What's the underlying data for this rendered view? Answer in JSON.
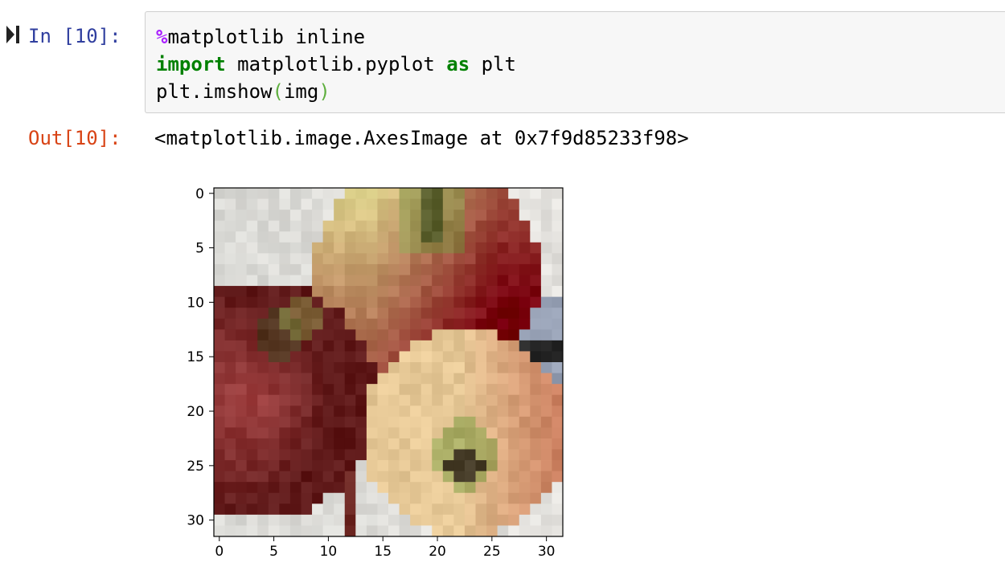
{
  "cell": {
    "input_prompt": {
      "prefix": "In ",
      "number": "[10]:"
    },
    "code": {
      "line1": {
        "magic": "%",
        "text": "matplotlib inline"
      },
      "line2": {
        "kw_import": "import",
        "middle": " matplotlib.pyplot ",
        "kw_as": "as",
        "end": " plt"
      },
      "line3": {
        "call": "plt.imshow",
        "open": "(",
        "arg": "img",
        "close": ")"
      }
    },
    "output_prompt": "Out[10]:",
    "output_text": "<matplotlib.image.AxesImage at 0x7f9d85233f98>"
  },
  "chart_data": {
    "type": "heatmap",
    "title": "",
    "xlabel": "",
    "ylabel": "",
    "xticks": [
      "0",
      "5",
      "10",
      "15",
      "20",
      "25",
      "30"
    ],
    "yticks": [
      "0",
      "5",
      "10",
      "15",
      "20",
      "25",
      "30"
    ],
    "xlim": [
      -0.5,
      31.5
    ],
    "ylim": [
      31.5,
      -0.5
    ],
    "image_size": [
      32,
      32
    ],
    "content": "32×32 low-resolution image of red and green apples"
  },
  "colors": {
    "prompt_in": "#303F9F",
    "prompt_out": "#D84315",
    "magic": "#AA22FF",
    "keyword": "#008000",
    "cell_background": "#f7f7f7"
  }
}
